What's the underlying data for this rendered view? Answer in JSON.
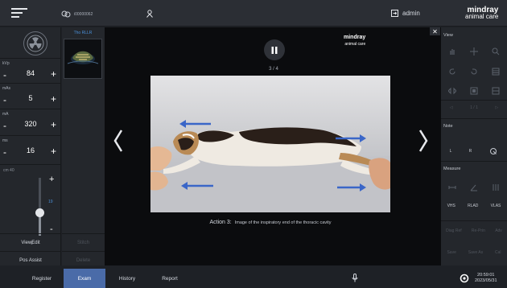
{
  "topbar": {
    "patient_id": "i00000062",
    "user": "admin",
    "brand_name": "mindray",
    "brand_sub": "animal care",
    "accent": "#4a6ba8"
  },
  "left": {
    "kvp": {
      "label": "kVp",
      "value": "84"
    },
    "mas": {
      "label": "mAs",
      "value": "5"
    },
    "ma": {
      "label": "mA",
      "value": "320"
    },
    "ms": {
      "label": "ms",
      "value": "16"
    },
    "slider": {
      "top_label": "cm 40",
      "value": "19",
      "bottom_label": "1",
      "level": 0.4
    },
    "thumbnail_label": "Tho RLLR",
    "buttons": [
      "ViewEdit",
      "Pos Assist"
    ],
    "buttons2": [
      "Stitch",
      "Delete"
    ]
  },
  "viewer": {
    "logo_name": "mindray",
    "logo_sub": "animal care",
    "counter": "3 / 4",
    "caption_action": "Action 3:",
    "caption_text": "Image of the inspiratory end of the thoracic cavity"
  },
  "right": {
    "view_label": "View",
    "page": "1 / 1",
    "note_label": "Note",
    "note_items": [
      "L",
      "R"
    ],
    "measure_label": "Measure",
    "measure_items": [
      "VHS",
      "RLAD",
      "VLAS"
    ],
    "dim_row1": [
      "Diag Ref",
      "Re-Prin",
      "Adv"
    ],
    "dim_row2": [
      "Save",
      "Save As",
      "Cal"
    ]
  },
  "bottom": {
    "tabs": [
      "Register",
      "Exam",
      "History",
      "Report"
    ],
    "active_tab": "Exam",
    "time": "20:59:01",
    "date": "2023/05/31"
  },
  "icons": [
    "menu-icon",
    "patient-icon",
    "person-icon",
    "login-icon",
    "radiation-icon",
    "pause-icon",
    "chevron-left-icon",
    "chevron-right-icon",
    "close-icon",
    "microphone-icon",
    "gear-icon"
  ]
}
